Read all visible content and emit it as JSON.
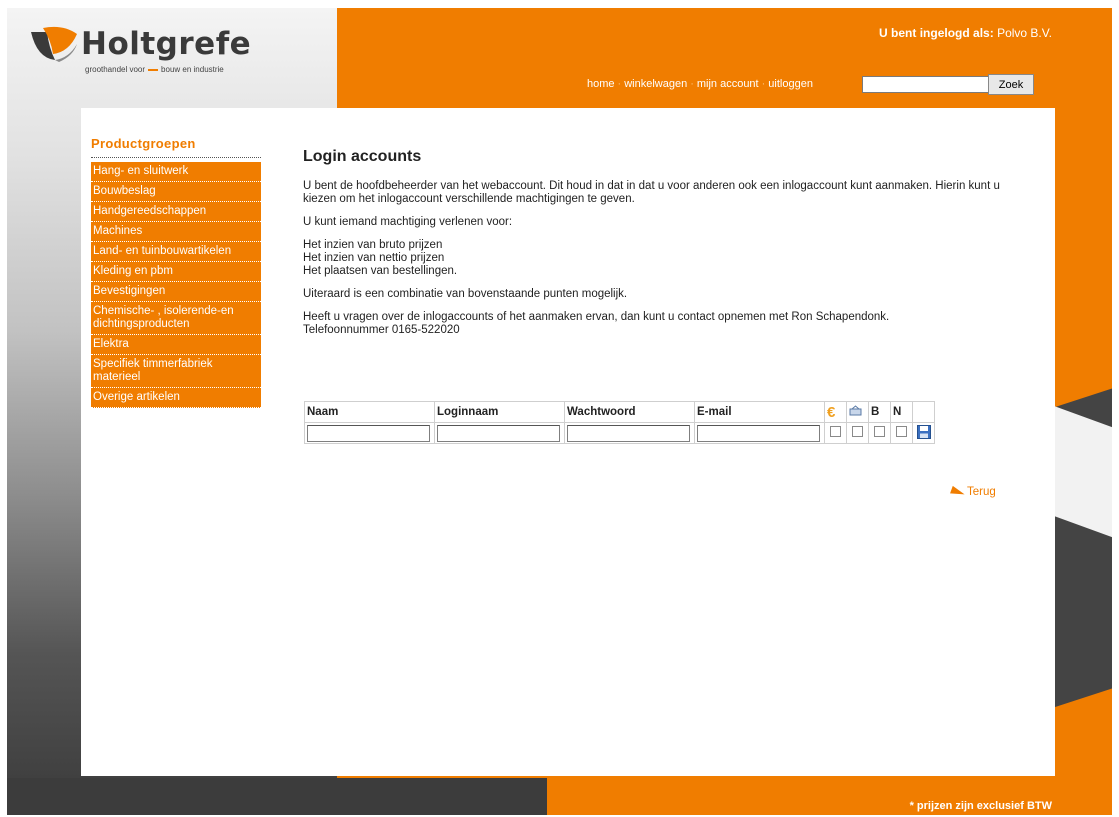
{
  "brand": {
    "name": "Holtgrefe",
    "tagline_left": "groothandel voor",
    "tagline_right": "bouw en industrie",
    "accent_color": "#f07d00"
  },
  "header": {
    "login_label": "U bent ingelogd als:",
    "login_user": "Polvo B.V.",
    "nav": [
      "home",
      "winkelwagen",
      "mijn account",
      "uitloggen"
    ],
    "search_placeholder": "",
    "search_button": "Zoek"
  },
  "sidebar": {
    "title": "Productgroepen",
    "items": [
      "Hang- en sluitwerk",
      "Bouwbeslag",
      "Handgereedschappen",
      "Machines",
      "Land- en tuinbouwartikelen",
      "Kleding en pbm",
      "Bevestigingen",
      "Chemische- , isolerende-en dichtingsproducten",
      "Elektra",
      "Specifiek timmerfabriek materieel",
      "Overige artikelen"
    ]
  },
  "main": {
    "title": "Login accounts",
    "paragraphs": [
      "U bent de hoofdbeheerder van het webaccount. Dit houd in dat in dat u voor anderen ook een inlogaccount kunt aanmaken. Hierin kunt u kiezen om het inlogaccount verschillende machtigingen te geven.",
      "U kunt iemand machtiging verlenen voor:",
      "Het inzien van bruto prijzen\nHet inzien van nettio prijzen\nHet plaatsen van bestellingen.",
      "Uiteraard is een combinatie van bovenstaande punten mogelijk.",
      "Heeft u vragen over de inlogaccounts of het aanmaken ervan, dan kunt u contact opnemen met Ron Schapendonk.\nTelefoonnummer 0165-522020"
    ],
    "table": {
      "headers": [
        "Naam",
        "Loginnaam",
        "Wachtwoord",
        "E-mail"
      ],
      "icon_headers": [
        "euro-icon",
        "basket-icon"
      ],
      "letter_headers": [
        "B",
        "N"
      ]
    },
    "back_link": "Terug"
  },
  "footer": {
    "note": "* prijzen zijn exclusief BTW"
  }
}
